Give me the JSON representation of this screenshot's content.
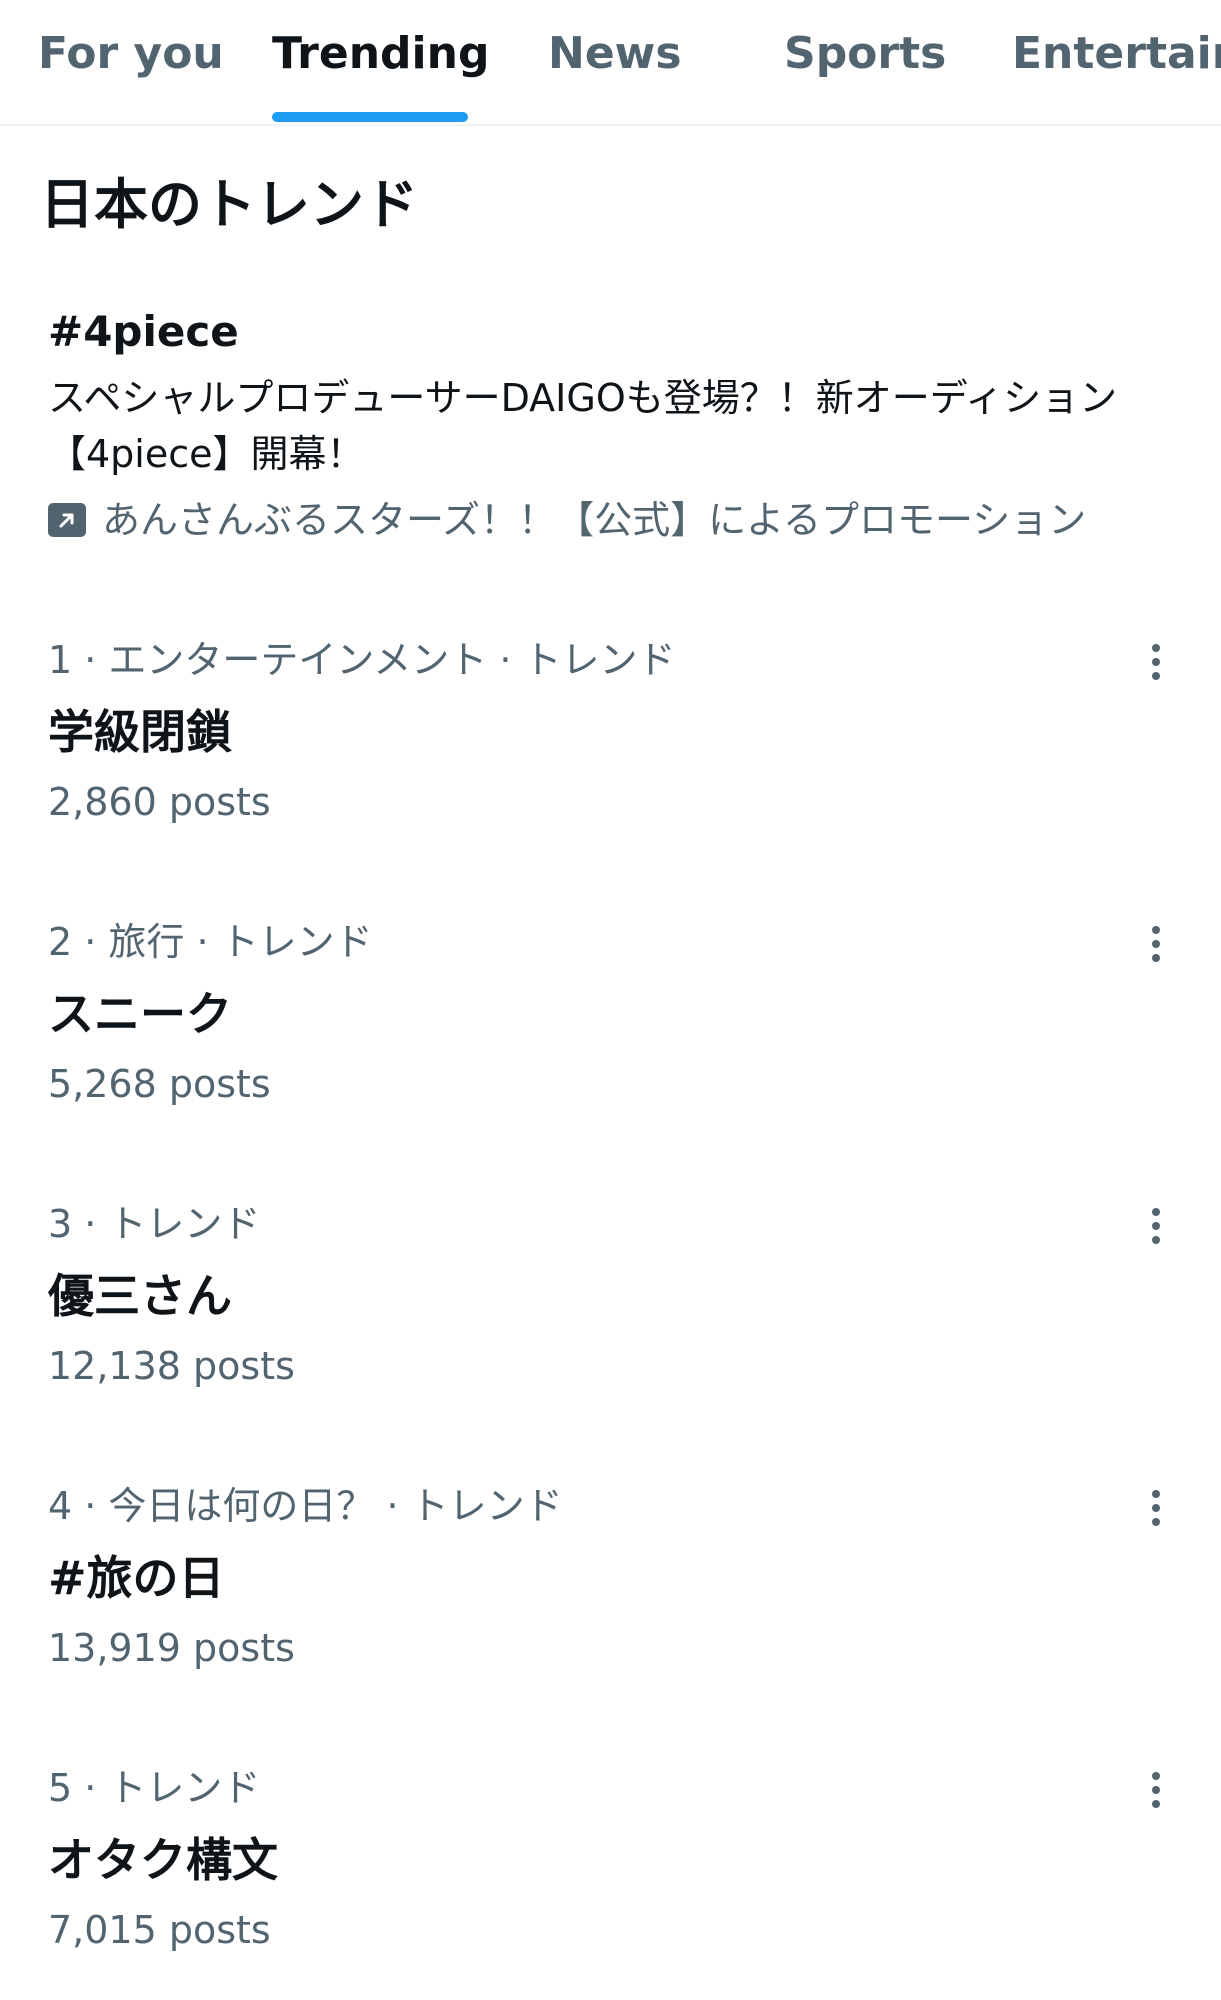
{
  "tabs": [
    {
      "label": "For you",
      "active": false
    },
    {
      "label": "Trending",
      "active": true
    },
    {
      "label": "News",
      "active": false
    },
    {
      "label": "Sports",
      "active": false
    },
    {
      "label": "Entertain",
      "active": false
    }
  ],
  "section_title": "日本のトレンド",
  "promoted": {
    "tag": "#4piece",
    "description": "スペシャルプロデューサーDAIGOも登場？！新オーディション【4piece】開幕！",
    "promoted_by": "あんさんぶるスターズ！！【公式】によるプロモーション",
    "icon": "promoted-arrow-icon"
  },
  "trends": [
    {
      "meta": "1 · エンターテインメント · トレンド",
      "name": "学級閉鎖",
      "posts": "2,860 posts"
    },
    {
      "meta": "2 · 旅行 · トレンド",
      "name": "スニーク",
      "posts": "5,268 posts"
    },
    {
      "meta": "3 · トレンド",
      "name": "優三さん",
      "posts": "12,138 posts"
    },
    {
      "meta": "4 · 今日は何の日？ · トレンド",
      "name": "#旅の日",
      "posts": "13,919 posts"
    },
    {
      "meta": "5 · トレンド",
      "name": "オタク構文",
      "posts": "7,015 posts"
    }
  ],
  "colors": {
    "accent": "#1d9bf0",
    "primary_text": "#0f1419",
    "secondary_text": "#536471",
    "divider": "#eff3f4"
  }
}
